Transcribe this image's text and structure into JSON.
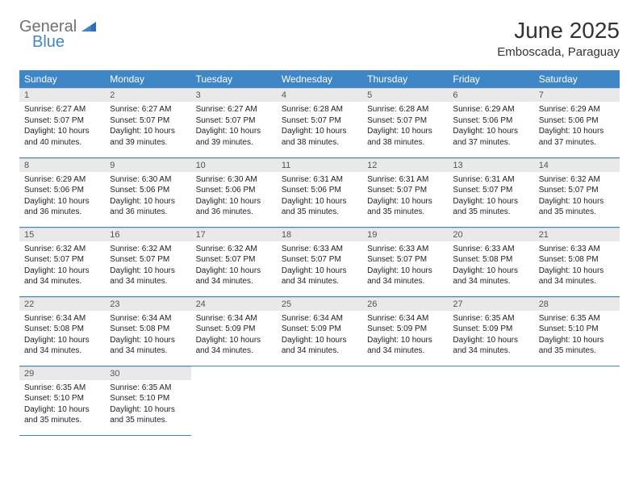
{
  "brand": {
    "text1": "General",
    "text2": "Blue"
  },
  "title": "June 2025",
  "location": "Emboscada, Paraguay",
  "weekdays": [
    "Sunday",
    "Monday",
    "Tuesday",
    "Wednesday",
    "Thursday",
    "Friday",
    "Saturday"
  ],
  "days": [
    {
      "n": 1,
      "sr": "6:27 AM",
      "ss": "5:07 PM",
      "dl": "10 hours and 40 minutes."
    },
    {
      "n": 2,
      "sr": "6:27 AM",
      "ss": "5:07 PM",
      "dl": "10 hours and 39 minutes."
    },
    {
      "n": 3,
      "sr": "6:27 AM",
      "ss": "5:07 PM",
      "dl": "10 hours and 39 minutes."
    },
    {
      "n": 4,
      "sr": "6:28 AM",
      "ss": "5:07 PM",
      "dl": "10 hours and 38 minutes."
    },
    {
      "n": 5,
      "sr": "6:28 AM",
      "ss": "5:07 PM",
      "dl": "10 hours and 38 minutes."
    },
    {
      "n": 6,
      "sr": "6:29 AM",
      "ss": "5:06 PM",
      "dl": "10 hours and 37 minutes."
    },
    {
      "n": 7,
      "sr": "6:29 AM",
      "ss": "5:06 PM",
      "dl": "10 hours and 37 minutes."
    },
    {
      "n": 8,
      "sr": "6:29 AM",
      "ss": "5:06 PM",
      "dl": "10 hours and 36 minutes."
    },
    {
      "n": 9,
      "sr": "6:30 AM",
      "ss": "5:06 PM",
      "dl": "10 hours and 36 minutes."
    },
    {
      "n": 10,
      "sr": "6:30 AM",
      "ss": "5:06 PM",
      "dl": "10 hours and 36 minutes."
    },
    {
      "n": 11,
      "sr": "6:31 AM",
      "ss": "5:06 PM",
      "dl": "10 hours and 35 minutes."
    },
    {
      "n": 12,
      "sr": "6:31 AM",
      "ss": "5:07 PM",
      "dl": "10 hours and 35 minutes."
    },
    {
      "n": 13,
      "sr": "6:31 AM",
      "ss": "5:07 PM",
      "dl": "10 hours and 35 minutes."
    },
    {
      "n": 14,
      "sr": "6:32 AM",
      "ss": "5:07 PM",
      "dl": "10 hours and 35 minutes."
    },
    {
      "n": 15,
      "sr": "6:32 AM",
      "ss": "5:07 PM",
      "dl": "10 hours and 34 minutes."
    },
    {
      "n": 16,
      "sr": "6:32 AM",
      "ss": "5:07 PM",
      "dl": "10 hours and 34 minutes."
    },
    {
      "n": 17,
      "sr": "6:32 AM",
      "ss": "5:07 PM",
      "dl": "10 hours and 34 minutes."
    },
    {
      "n": 18,
      "sr": "6:33 AM",
      "ss": "5:07 PM",
      "dl": "10 hours and 34 minutes."
    },
    {
      "n": 19,
      "sr": "6:33 AM",
      "ss": "5:07 PM",
      "dl": "10 hours and 34 minutes."
    },
    {
      "n": 20,
      "sr": "6:33 AM",
      "ss": "5:08 PM",
      "dl": "10 hours and 34 minutes."
    },
    {
      "n": 21,
      "sr": "6:33 AM",
      "ss": "5:08 PM",
      "dl": "10 hours and 34 minutes."
    },
    {
      "n": 22,
      "sr": "6:34 AM",
      "ss": "5:08 PM",
      "dl": "10 hours and 34 minutes."
    },
    {
      "n": 23,
      "sr": "6:34 AM",
      "ss": "5:08 PM",
      "dl": "10 hours and 34 minutes."
    },
    {
      "n": 24,
      "sr": "6:34 AM",
      "ss": "5:09 PM",
      "dl": "10 hours and 34 minutes."
    },
    {
      "n": 25,
      "sr": "6:34 AM",
      "ss": "5:09 PM",
      "dl": "10 hours and 34 minutes."
    },
    {
      "n": 26,
      "sr": "6:34 AM",
      "ss": "5:09 PM",
      "dl": "10 hours and 34 minutes."
    },
    {
      "n": 27,
      "sr": "6:35 AM",
      "ss": "5:09 PM",
      "dl": "10 hours and 34 minutes."
    },
    {
      "n": 28,
      "sr": "6:35 AM",
      "ss": "5:10 PM",
      "dl": "10 hours and 35 minutes."
    },
    {
      "n": 29,
      "sr": "6:35 AM",
      "ss": "5:10 PM",
      "dl": "10 hours and 35 minutes."
    },
    {
      "n": 30,
      "sr": "6:35 AM",
      "ss": "5:10 PM",
      "dl": "10 hours and 35 minutes."
    }
  ],
  "labels": {
    "sunrise": "Sunrise:",
    "sunset": "Sunset:",
    "daylight": "Daylight:"
  }
}
